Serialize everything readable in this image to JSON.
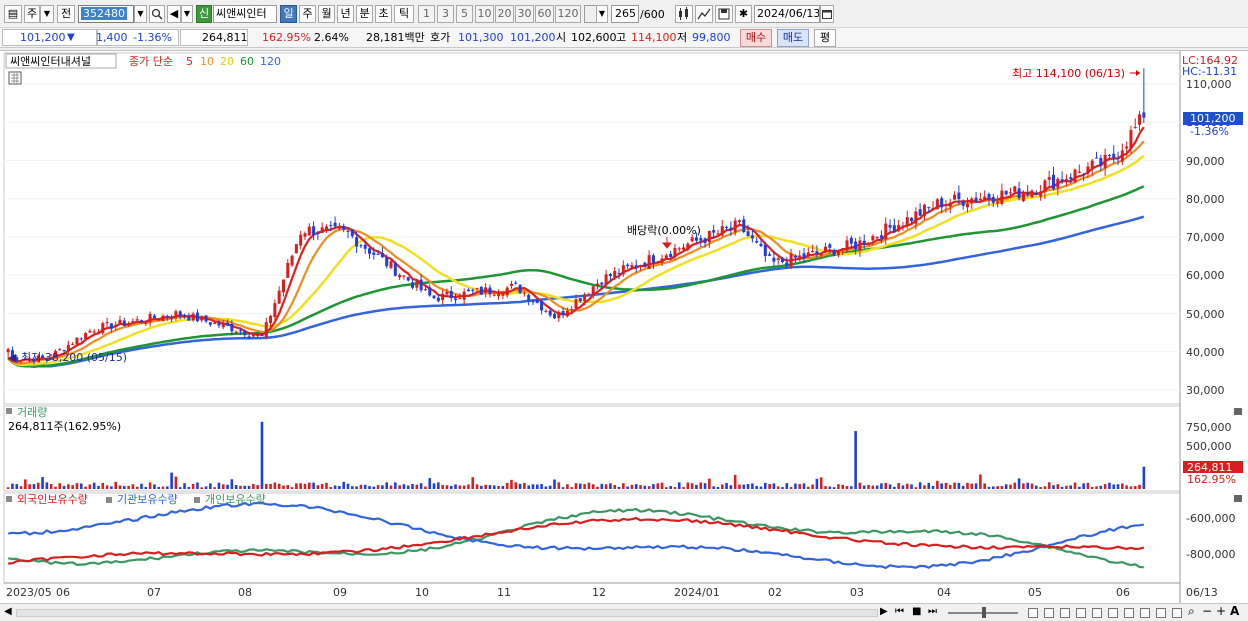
{
  "toolbar": {
    "period_type": "주",
    "prev_label": "전",
    "stock_code": "352480",
    "new_badge": "신",
    "stock_name": "씨앤씨인터",
    "period_buttons": [
      "일",
      "주",
      "월",
      "년",
      "분",
      "초",
      "틱"
    ],
    "active_period": "일",
    "interval_buttons": [
      "1",
      "3",
      "5",
      "10",
      "20",
      "30",
      "60",
      "120"
    ],
    "count_value": "265",
    "count_max": "/600",
    "date_value": "2024/06/13"
  },
  "quote": {
    "price": "101,200",
    "change": "1,400",
    "change_pct": "-1.36%",
    "volume": "264,811",
    "volume_ratio": "162.95%",
    "turnover": "2.64%",
    "amount": "28,181백만",
    "bid_label": "호가",
    "ask_price": "101,300",
    "bid_price": "101,200",
    "open_label": "시",
    "open": "102,600",
    "high_label": "고",
    "high": "114,100",
    "low_label": "저",
    "low": "99,800",
    "buy_button": "매수",
    "sell_button": "매도",
    "eval_button": "평"
  },
  "price_panel": {
    "title": "씨앤씨인터내셔널",
    "ma_label": "종가 단순",
    "ma_periods": [
      "5",
      "10",
      "20",
      "60",
      "120"
    ],
    "lc_label": "LC:164.92",
    "hc_label": "HC:-11.31",
    "high_annotation": "최고 114,100 (06/13)",
    "low_annotation": "최저 38,200 (05/15)",
    "dividend_annotation": "배당락(0.00%)",
    "current_price_tag": "101,200",
    "current_pct_tag": "-1.36%",
    "y_ticks": [
      "110,000",
      "100,000",
      "90,000",
      "80,000",
      "70,000",
      "60,000",
      "50,000",
      "40,000",
      "30,000"
    ]
  },
  "volume_panel": {
    "title": "거래량",
    "info": "264,811주(162.95%)",
    "y_ticks": [
      "750,000",
      "500,000",
      "250,000"
    ],
    "current_tag": "264,811",
    "current_pct": "162.95%"
  },
  "holdings_panel": {
    "legends": [
      "외국인보유수량",
      "기관보유수량",
      "개인보유수량"
    ],
    "y_ticks": [
      "-600,000",
      "-800,000"
    ]
  },
  "x_axis": {
    "labels": [
      "2023/05",
      "06",
      "07",
      "08",
      "09",
      "10",
      "11",
      "12",
      "2024/01",
      "02",
      "03",
      "04",
      "05",
      "06"
    ],
    "right_label": "06/13"
  },
  "colors": {
    "up": "#d81e1e",
    "down": "#1e3ee0",
    "ma5": "#e02020",
    "ma10": "#f08c1e",
    "ma20": "#f0e020",
    "ma60": "#1e9632",
    "ma120": "#3264dc",
    "foreign": "#d81e1e",
    "institution": "#3264dc",
    "individual": "#3c9664"
  },
  "chart_data": {
    "type": "candlestick",
    "x_range": [
      "2023/05",
      "2024/06/13"
    ],
    "ylim": [
      30000,
      110000
    ],
    "close_anchors": [
      {
        "date": "2023/05/15",
        "value": 38200
      },
      {
        "date": "2023/06",
        "value": 46000
      },
      {
        "date": "2023/07",
        "value": 50000
      },
      {
        "date": "2023/08",
        "value": 44000
      },
      {
        "date": "2023/08/15",
        "value": 72000
      },
      {
        "date": "2023/09",
        "value": 71000
      },
      {
        "date": "2023/10",
        "value": 54000
      },
      {
        "date": "2023/11",
        "value": 57000
      },
      {
        "date": "2023/11/15",
        "value": 49000
      },
      {
        "date": "2023/12",
        "value": 59000
      },
      {
        "date": "2024/01",
        "value": 68000
      },
      {
        "date": "2024/01/20",
        "value": 73000
      },
      {
        "date": "2024/02",
        "value": 63000
      },
      {
        "date": "2024/03",
        "value": 68000
      },
      {
        "date": "2024/04",
        "value": 79000
      },
      {
        "date": "2024/05",
        "value": 82000
      },
      {
        "date": "2024/06",
        "value": 90000
      },
      {
        "date": "2024/06/13",
        "value": 101200
      }
    ],
    "high": {
      "date": "2024/06/13",
      "value": 114100
    },
    "low": {
      "date": "2023/05/15",
      "value": 38200
    },
    "volume_ylim": [
      0,
      750000
    ],
    "volume_spikes": [
      {
        "date": "2023/08",
        "value": 800000
      },
      {
        "date": "2024/03",
        "value": 690000
      },
      {
        "date": "2024/06/13",
        "value": 264811
      }
    ]
  }
}
